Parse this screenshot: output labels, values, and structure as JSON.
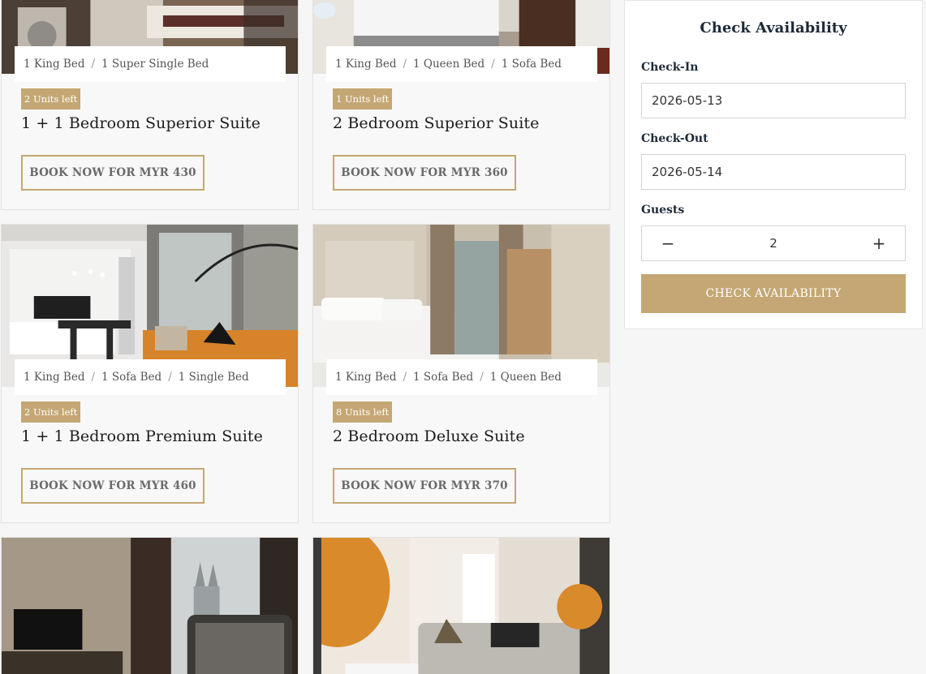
{
  "rooms": [
    {
      "beds": [
        "1 King Bed",
        "1 Super Single Bed"
      ],
      "units": "2 Units left",
      "title": "1 + 1 Bedroom Superior Suite",
      "button": "BOOK NOW FOR MYR 430"
    },
    {
      "beds": [
        "1 King Bed",
        "1 Queen Bed",
        "1 Sofa Bed"
      ],
      "units": "1 Units left",
      "title": "2 Bedroom Superior Suite",
      "button": "BOOK NOW FOR MYR 360"
    },
    {
      "beds": [
        "1 King Bed",
        "1 Sofa Bed",
        "1 Single Bed"
      ],
      "units": "2 Units left",
      "title": "1 + 1 Bedroom Premium Suite",
      "button": "BOOK NOW FOR MYR 460"
    },
    {
      "beds": [
        "1 King Bed",
        "1 Sofa Bed",
        "1 Queen Bed"
      ],
      "units": "8 Units left",
      "title": "2 Bedroom Deluxe Suite",
      "button": "BOOK NOW FOR MYR 370"
    }
  ],
  "sep": "/",
  "availability": {
    "title": "Check Availability",
    "checkin_label": "Check-In",
    "checkin_value": "2026-05-13",
    "checkout_label": "Check-Out",
    "checkout_value": "2026-05-14",
    "guests_label": "Guests",
    "guests_value": "2",
    "minus": "−",
    "plus": "+",
    "button": "CHECK AVAILABILITY"
  },
  "colors": {
    "accent": "#c4a774",
    "heading": "#1e2a38"
  }
}
